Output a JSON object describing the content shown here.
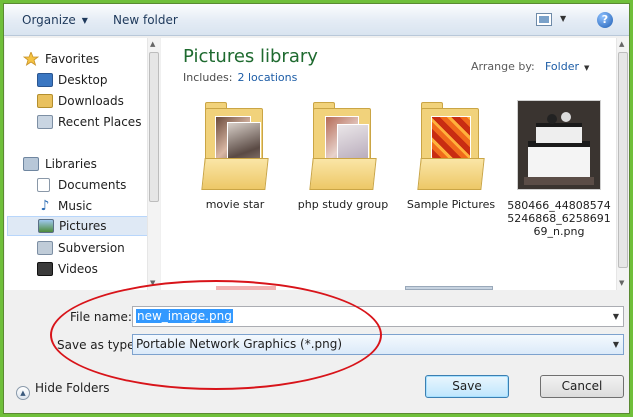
{
  "toolbar": {
    "organize_label": "Organize",
    "new_folder_label": "New folder",
    "view_icon": "view-icon",
    "help_glyph": "?"
  },
  "nav": {
    "favorites_label": "Favorites",
    "favorites": [
      {
        "label": "Desktop",
        "icon": "desktop-icon"
      },
      {
        "label": "Downloads",
        "icon": "downloads-icon"
      },
      {
        "label": "Recent Places",
        "icon": "recent-places-icon"
      }
    ],
    "libraries_label": "Libraries",
    "libraries": [
      {
        "label": "Documents",
        "icon": "documents-icon"
      },
      {
        "label": "Music",
        "icon": "music-icon"
      },
      {
        "label": "Pictures",
        "icon": "pictures-icon",
        "selected": true
      },
      {
        "label": "Subversion",
        "icon": "subversion-icon"
      },
      {
        "label": "Videos",
        "icon": "videos-icon"
      }
    ]
  },
  "content": {
    "title": "Pictures library",
    "includes_label": "Includes:",
    "includes_link": "2 locations",
    "arrange_label": "Arrange by:",
    "arrange_value": "Folder",
    "items": [
      {
        "label": "movie star",
        "type": "folder"
      },
      {
        "label": "php study group",
        "type": "folder"
      },
      {
        "label": "Sample Pictures",
        "type": "folder"
      },
      {
        "label": "580466_448085745246868_625869169_n.png",
        "type": "image"
      }
    ]
  },
  "save_form": {
    "file_name_label": "File name:",
    "file_name_value": "new_image.png",
    "save_type_label": "Save as type:",
    "save_type_value": "Portable Network Graphics (*.png)"
  },
  "footer": {
    "hide_folders_label": "Hide Folders",
    "save_label": "Save",
    "cancel_label": "Cancel"
  },
  "colors": {
    "accent_title": "#1e6a2f",
    "link": "#1c5ca6",
    "annotation_ring": "#d8141a",
    "window_frame": "#6fbf3a"
  }
}
